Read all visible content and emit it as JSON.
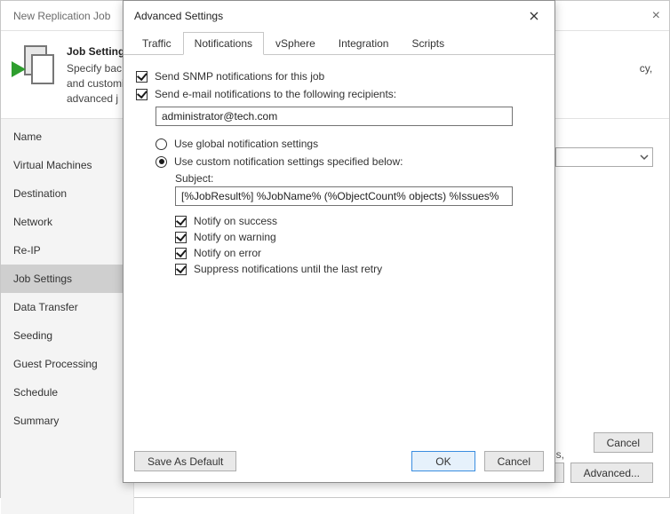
{
  "parent": {
    "title": "New Replication Job",
    "heading": "Job Settings",
    "subtitle_prefix": "Specify bac",
    "subtitle_suffix": "cy, and customize",
    "subtitle_line2_prefix": "advanced j",
    "sidebar": [
      "Name",
      "Virtual Machines",
      "Destination",
      "Network",
      "Re-IP",
      "Job Settings",
      "Data Transfer",
      "Seeding",
      "Guest Processing",
      "Schedule",
      "Summary"
    ],
    "selected_sidebar_index": 5,
    "hint_suffix": "s,",
    "footer": {
      "advanced": "Advanced...",
      "h_suffix": "h",
      "cancel": "Cancel"
    }
  },
  "modal": {
    "title": "Advanced Settings",
    "tabs": [
      "Traffic",
      "Notifications",
      "vSphere",
      "Integration",
      "Scripts"
    ],
    "active_tab_index": 1,
    "snmp_label": "Send SNMP notifications for this job",
    "snmp_checked": true,
    "email_label": "Send e-mail notifications to the following recipients:",
    "email_checked": true,
    "email_value": "administrator@tech.com",
    "radio_global_label": "Use global notification settings",
    "radio_custom_label": "Use custom notification settings specified below:",
    "radio_selected": "custom",
    "subject_label": "Subject:",
    "subject_value": "[%JobResult%] %JobName% (%ObjectCount% objects) %Issues%",
    "notify": {
      "success": {
        "label": "Notify on success",
        "checked": true
      },
      "warning": {
        "label": "Notify on warning",
        "checked": true
      },
      "error": {
        "label": "Notify on error",
        "checked": true
      },
      "suppress": {
        "label": "Suppress notifications until the last retry",
        "checked": true
      }
    },
    "footer": {
      "save_default": "Save As Default",
      "ok": "OK",
      "cancel": "Cancel"
    }
  }
}
